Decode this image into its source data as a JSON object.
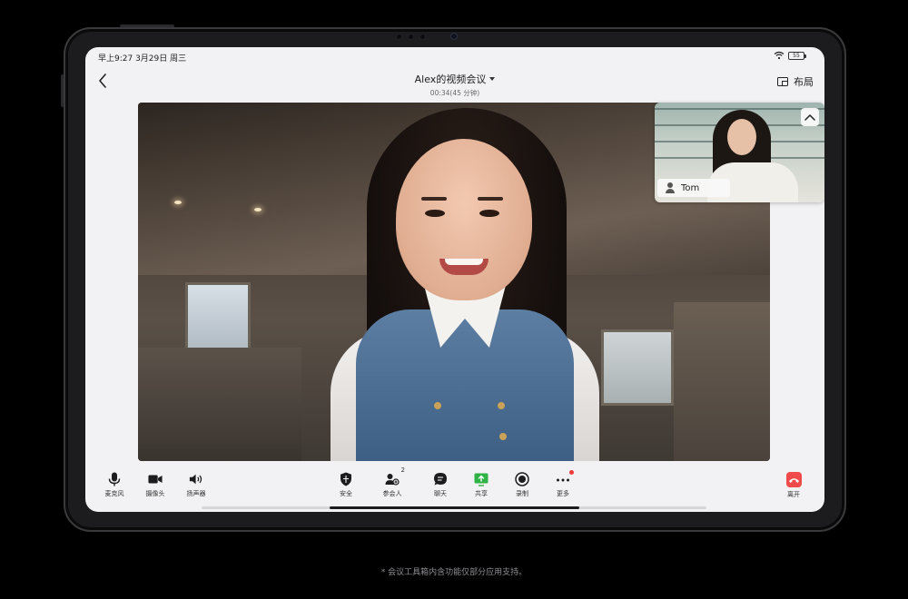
{
  "status_bar": {
    "time": "早上9:27 3月29日 周三",
    "battery": "55"
  },
  "header": {
    "title": "Alex的视频会议",
    "timer": "00:34(45 分钟)",
    "layout_label": "布局"
  },
  "pip": {
    "participant_name": "Tom"
  },
  "toolbar": {
    "left": [
      {
        "label": "麦克风",
        "icon": "microphone-icon"
      },
      {
        "label": "摄像头",
        "icon": "camera-icon"
      },
      {
        "label": "扬声器",
        "icon": "speaker-icon"
      }
    ],
    "center": [
      {
        "label": "安全",
        "icon": "shield-icon"
      },
      {
        "label": "参会人",
        "icon": "participants-icon",
        "badge": "2"
      },
      {
        "label": "聊天",
        "icon": "chat-icon"
      },
      {
        "label": "共享",
        "icon": "share-screen-icon"
      },
      {
        "label": "录制",
        "icon": "record-icon"
      },
      {
        "label": "更多",
        "icon": "more-icon"
      }
    ],
    "right": [
      {
        "label": "离开",
        "icon": "hang-up-icon"
      }
    ]
  },
  "colors": {
    "share_green": "#2fb344",
    "leave_red": "#f04a4a",
    "notification_red": "#f03a3a"
  },
  "footnote": "* 会议工具箱内含功能仅部分应用支持。"
}
